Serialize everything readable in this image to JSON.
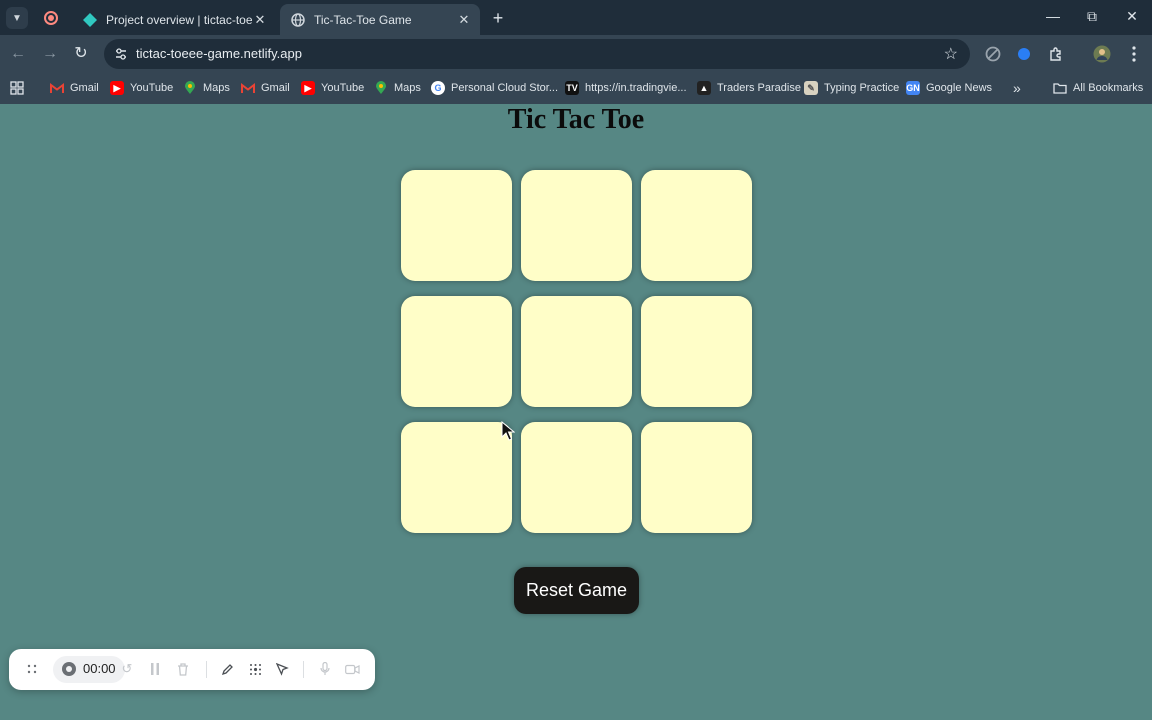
{
  "browser": {
    "tabs": [
      {
        "title": "Project overview | tictac-toeee-",
        "active": false
      },
      {
        "title": "Tic-Tac-Toe Game",
        "active": true
      }
    ],
    "url": "tictac-toeee-game.netlify.app",
    "bookmarks": [
      {
        "label": "Gmail",
        "icon": "gmail-icon"
      },
      {
        "label": "YouTube",
        "icon": "youtube-icon"
      },
      {
        "label": "Maps",
        "icon": "maps-icon"
      },
      {
        "label": "Gmail",
        "icon": "gmail-icon"
      },
      {
        "label": "YouTube",
        "icon": "youtube-icon"
      },
      {
        "label": "Maps",
        "icon": "maps-icon"
      },
      {
        "label": "Personal Cloud Stor...",
        "icon": "google-icon"
      },
      {
        "label": "https://in.tradingvie...",
        "icon": "tradingview-icon"
      },
      {
        "label": "Traders Paradise",
        "icon": "traders-paradise-icon"
      },
      {
        "label": "Typing Practice",
        "icon": "typing-practice-icon"
      },
      {
        "label": "Google News",
        "icon": "google-news-icon"
      }
    ],
    "all_bookmarks_label": "All Bookmarks"
  },
  "game": {
    "title": "Tic Tac Toe",
    "cells": [
      "",
      "",
      "",
      "",
      "",
      "",
      "",
      "",
      ""
    ],
    "reset_label": "Reset Game"
  },
  "recorder": {
    "time": "00:00"
  },
  "colors": {
    "page_background": "#568784",
    "cell_background": "#fffec8",
    "reset_button": "#191816"
  }
}
